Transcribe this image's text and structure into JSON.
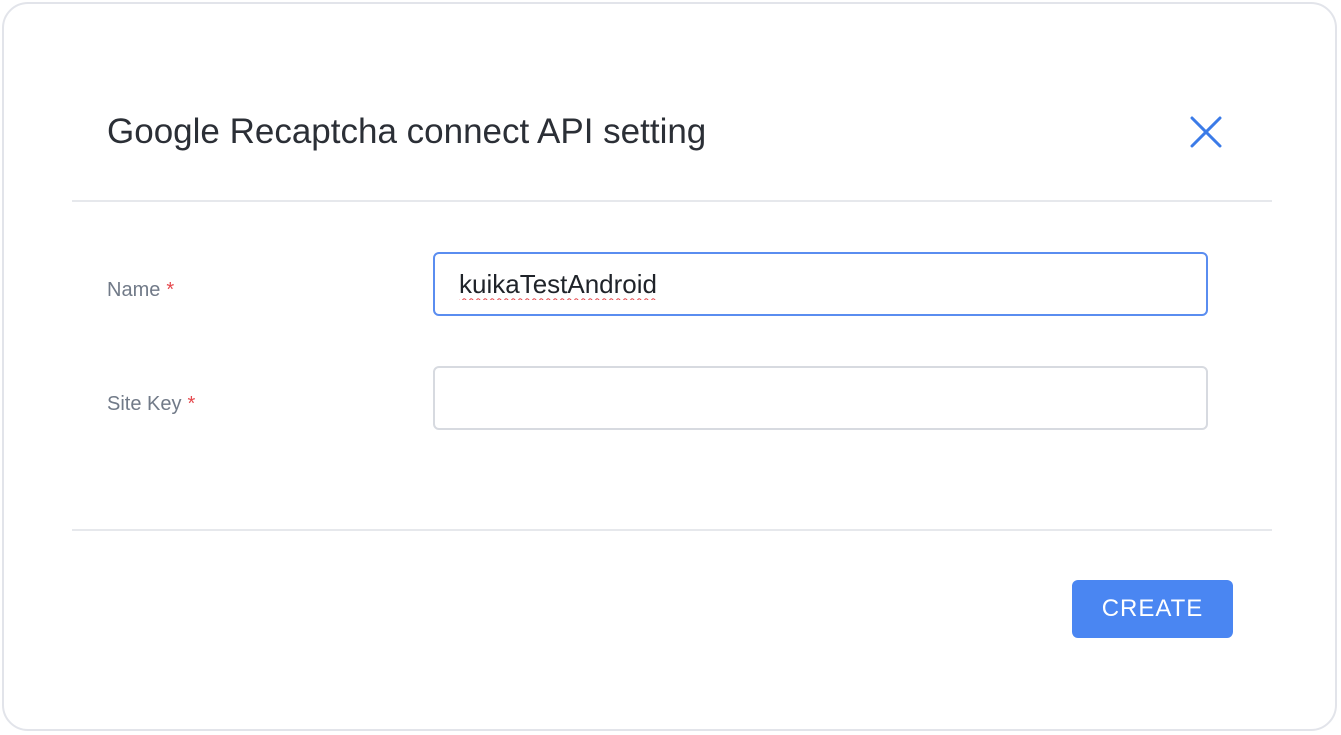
{
  "dialog": {
    "title": "Google Recaptcha connect API setting",
    "close_icon": "close-icon"
  },
  "form": {
    "name": {
      "label": "Name",
      "required_mark": "*",
      "value": "kuikaTestAndroid"
    },
    "site_key": {
      "label": "Site Key",
      "required_mark": "*",
      "value": ""
    }
  },
  "footer": {
    "create_label": "CREATE"
  },
  "colors": {
    "accent": "#4a86f2",
    "required": "#e5484d",
    "focus_border": "#5a8df0"
  }
}
